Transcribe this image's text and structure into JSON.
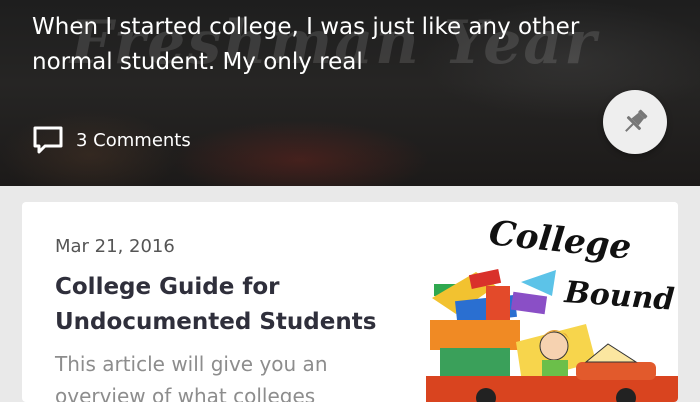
{
  "hero": {
    "background_title": "Freshman Year",
    "excerpt": "When I started college, I was just like any other normal student. My only real",
    "comments_label": "3 Comments",
    "comment_icon": "comment-icon",
    "pin_icon": "pushpin-icon"
  },
  "article": {
    "date": "Mar 21, 2016",
    "title": "College Guide for Undocumented Students",
    "summary": "This article will give you an overview of what colleges",
    "thumbnail": {
      "line1": "College",
      "line2": "Bound"
    }
  },
  "colors": {
    "hero_bg": "#1e1e1e",
    "card_bg": "#ffffff",
    "page_bg": "#e9e9e9",
    "title_text": "#2f2f3b",
    "summary_text": "#8d8d8d"
  }
}
